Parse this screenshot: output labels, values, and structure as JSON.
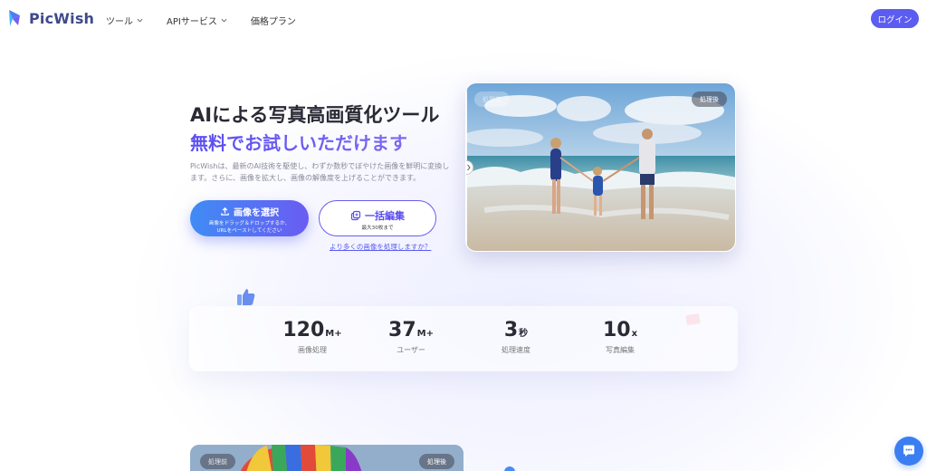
{
  "brand": {
    "name": "PicWish"
  },
  "nav": {
    "items": [
      {
        "label": "ツール"
      },
      {
        "label": "APIサービス"
      },
      {
        "label": "価格プラン"
      }
    ],
    "login_label": "ログイン"
  },
  "hero": {
    "title": "AIによる写真高画質化ツール",
    "subtitle": "無料でお試しいただけます",
    "description": "PicWishは、最新のAI技術を駆使し、わずか数秒でぼやけた画像を鮮明に変換します。さらに、画像を拡大し、画像の解像度を上げることができます。",
    "select_button": {
      "label": "画像を選択",
      "hint_line1": "画像をドラッグ＆ドロップするか、",
      "hint_line2": "URLをペーストしてください"
    },
    "batch_button": {
      "label": "一括編集",
      "hint": "最大30枚まで"
    },
    "more_link": "より多くの画像を処理しますか？",
    "image_tags": {
      "before": "処理前",
      "after": "処理後"
    }
  },
  "stats": [
    {
      "value": "120",
      "unit": "M+",
      "label": "画像処理"
    },
    {
      "value": "37",
      "unit": "M+",
      "label": "ユーザー"
    },
    {
      "value": "3",
      "unit": "秒",
      "label": "処理速度"
    },
    {
      "value": "10",
      "unit": "x",
      "label": "写真編集"
    }
  ],
  "bottom_card": {
    "before": "処理前",
    "after": "処理後"
  },
  "colors": {
    "accent": "#5b5cf0",
    "brand": "#3f4a8c",
    "chat": "#3b7ef2"
  },
  "icons": [
    "picwish-logo-icon",
    "chevron-down-icon",
    "upload-icon",
    "batch-icon",
    "thumbs-up-icon",
    "chat-icon"
  ]
}
